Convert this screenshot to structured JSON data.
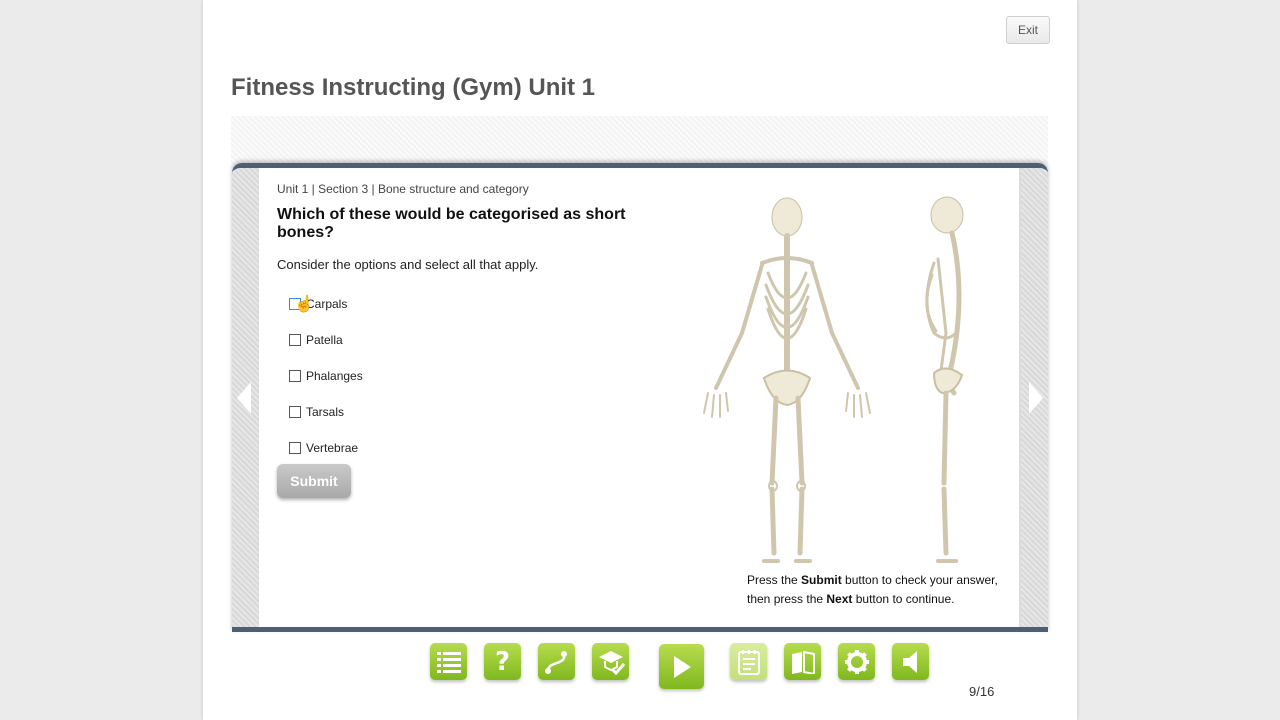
{
  "header": {
    "exit_label": "Exit",
    "course_title": "Fitness Instructing (Gym) Unit 1"
  },
  "slide": {
    "breadcrumb": "Unit 1 | Section 3 | Bone structure and category",
    "question": "Which of these would be categorised as short bones?",
    "instruction": "Consider the options and select all that apply.",
    "options": [
      {
        "label": "Carpals",
        "checked": false
      },
      {
        "label": "Patella",
        "checked": false
      },
      {
        "label": "Phalanges",
        "checked": false
      },
      {
        "label": "Tarsals",
        "checked": false
      },
      {
        "label": "Vertebrae",
        "checked": false
      }
    ],
    "submit_label": "Submit",
    "hint": {
      "part1": "Press the ",
      "submit_word": "Submit",
      "part2": " button to check your answer, then press the ",
      "next_word": "Next",
      "part3": " button to continue."
    }
  },
  "toolbar": {
    "icons": [
      "menu-list-icon",
      "help-icon",
      "path-icon",
      "graduation-check-icon",
      "play-icon",
      "notes-icon",
      "book-icon",
      "gear-icon",
      "audio-icon"
    ]
  },
  "pagination": {
    "page_count": "9/16"
  },
  "colors": {
    "accent_green": "#8cc43c",
    "stage_border": "#4c5f75",
    "title_gray": "#555555"
  }
}
